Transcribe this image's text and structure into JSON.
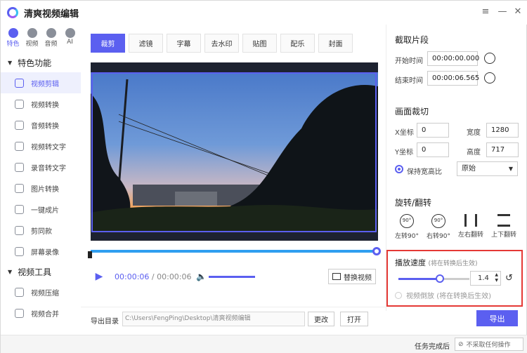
{
  "app": {
    "title": "清爽视频编辑"
  },
  "window_controls": {
    "menu": "≡",
    "minimize": "—",
    "close": "✕"
  },
  "categories": [
    {
      "label": "特色",
      "icon": "star-icon"
    },
    {
      "label": "视频",
      "icon": "video-icon"
    },
    {
      "label": "音频",
      "icon": "audio-icon"
    },
    {
      "label": "AI",
      "icon": "ai-icon"
    }
  ],
  "sidebar": {
    "group1": "特色功能",
    "items1": [
      "视频剪辑",
      "视频转换",
      "音频转换",
      "视频转文字",
      "录音转文字",
      "图片转换",
      "一键成片",
      "剪同款",
      "屏幕录像"
    ],
    "group2": "视频工具",
    "items2": [
      "视频压缩",
      "视频合并"
    ]
  },
  "tabs": [
    "裁剪",
    "滤镜",
    "字幕",
    "去水印",
    "贴图",
    "配乐",
    "封面"
  ],
  "player": {
    "current_time": "00:00:06",
    "separator": " / ",
    "total_time": "00:00:06",
    "replace_label": "替换视频",
    "progress": 1.0,
    "volume": 1.0
  },
  "footer": {
    "output_label": "导出目录",
    "output_path": "C:\\Users\\FengPing\\Desktop\\清爽视频编辑",
    "change_label": "更改",
    "open_label": "打开",
    "export_label": "导出",
    "task_label": "任务完成后",
    "task_option": "不采取任何操作"
  },
  "clip": {
    "title": "截取片段",
    "start_label": "开始时间",
    "start_value": "00:00:00.000",
    "end_label": "结束时间",
    "end_value": "00:00:06.565"
  },
  "crop": {
    "title": "画面裁切",
    "x_label": "X坐标",
    "x_value": "0",
    "width_label": "宽度",
    "width_value": "1280",
    "y_label": "Y坐标",
    "y_value": "0",
    "height_label": "高度",
    "height_value": "717",
    "keep_ratio_label": "保持宽高比",
    "ratio_value": "原始"
  },
  "rotate": {
    "title": "旋转/翻转",
    "left": "左转90°",
    "right": "右转90°",
    "flip_h": "左右翻转",
    "flip_v": "上下翻转",
    "left_badge": "90°",
    "right_badge": "90°"
  },
  "speed": {
    "title": "播放速度",
    "note": "(将在转换后生效)",
    "value": "1.4",
    "slider_fraction": 0.58,
    "reverse_label": "视频倒放",
    "reverse_note": "(将在转换后生效)"
  },
  "colors": {
    "accent": "#5b5ff0",
    "highlight": "#e53935"
  }
}
